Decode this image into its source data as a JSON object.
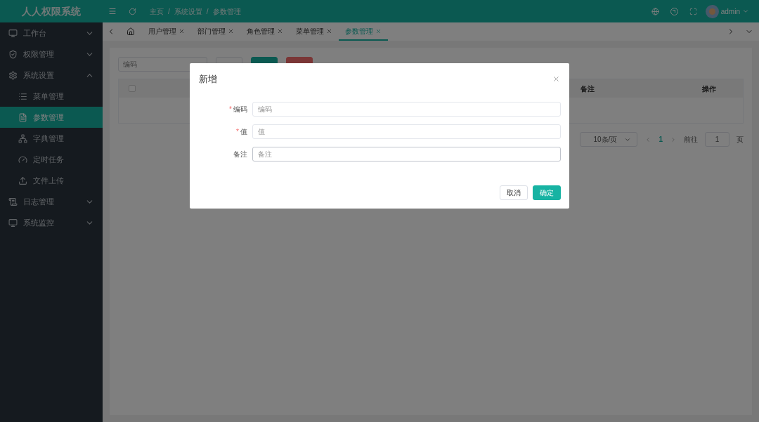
{
  "app": {
    "title": "人人权限系统"
  },
  "breadcrumb": {
    "separator": "/",
    "items": [
      "主页",
      "系统设置",
      "参数管理"
    ]
  },
  "user": {
    "name": "admin"
  },
  "sidebar": {
    "items": [
      {
        "label": "工作台",
        "expanded": false
      },
      {
        "label": "权限管理",
        "expanded": false
      },
      {
        "label": "系统设置",
        "expanded": true,
        "children": [
          {
            "label": "菜单管理",
            "selected": false
          },
          {
            "label": "参数管理",
            "selected": true
          },
          {
            "label": "字典管理",
            "selected": false
          },
          {
            "label": "定时任务",
            "selected": false
          },
          {
            "label": "文件上传",
            "selected": false
          }
        ]
      },
      {
        "label": "日志管理",
        "expanded": false
      },
      {
        "label": "系统监控",
        "expanded": false
      }
    ]
  },
  "tabs": [
    {
      "label": "用户管理",
      "selected": false
    },
    {
      "label": "部门管理",
      "selected": false
    },
    {
      "label": "角色管理",
      "selected": false
    },
    {
      "label": "菜单管理",
      "selected": false
    },
    {
      "label": "参数管理",
      "selected": true
    }
  ],
  "toolbar": {
    "search_placeholder": "编码",
    "buttons": [
      {
        "kind": "default"
      },
      {
        "kind": "primary"
      },
      {
        "kind": "danger"
      }
    ]
  },
  "table": {
    "select_all": {
      "checked": false
    },
    "columns": [
      "备注",
      "操作"
    ]
  },
  "pagination": {
    "page_size": "10条/页",
    "pages": [
      {
        "label": "1",
        "selected": true
      }
    ],
    "goto_label": "前往",
    "goto_value": "1",
    "page_suffix": "页"
  },
  "dialog": {
    "title": "新增",
    "required_mark": "*",
    "fields": [
      {
        "label": "编码",
        "placeholder": "编码",
        "required": true
      },
      {
        "label": "值",
        "placeholder": "值",
        "required": true
      },
      {
        "label": "备注",
        "placeholder": "备注",
        "required": false
      }
    ],
    "buttons": [
      {
        "label": "取消",
        "kind": "default"
      },
      {
        "label": "确定",
        "kind": "primary"
      }
    ]
  }
}
